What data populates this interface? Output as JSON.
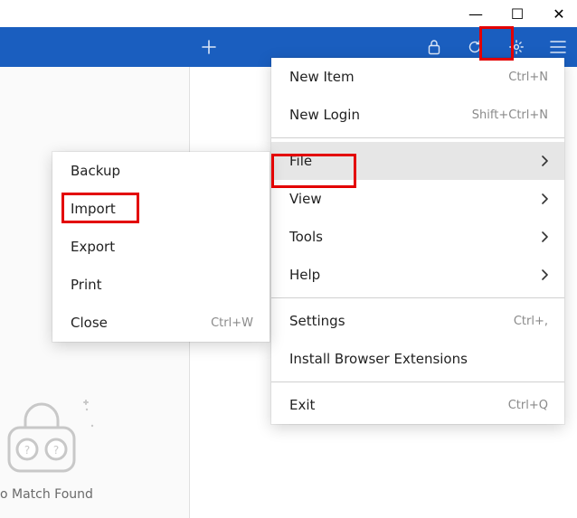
{
  "status_text": "o Match Found",
  "topbar": {
    "plus": "+",
    "lock_icon": "lock",
    "refresh_icon": "refresh",
    "gear_icon": "gear",
    "menu_icon": "hamburger"
  },
  "window_controls": {
    "minimize": "—",
    "maximize": "☐",
    "close": "✕"
  },
  "main_menu": [
    {
      "label": "New Item",
      "shortcut": "Ctrl+N"
    },
    {
      "label": "New Login",
      "shortcut": "Shift+Ctrl+N"
    },
    {
      "sep": true
    },
    {
      "label": "File",
      "submenu": true,
      "hover": true
    },
    {
      "label": "View",
      "submenu": true
    },
    {
      "label": "Tools",
      "submenu": true
    },
    {
      "label": "Help",
      "submenu": true
    },
    {
      "sep": true
    },
    {
      "label": "Settings",
      "shortcut": "Ctrl+,"
    },
    {
      "label": "Install Browser Extensions"
    },
    {
      "sep": true
    },
    {
      "label": "Exit",
      "shortcut": "Ctrl+Q"
    }
  ],
  "file_submenu": [
    {
      "label": "Backup"
    },
    {
      "label": "Import"
    },
    {
      "label": "Export"
    },
    {
      "label": "Print"
    },
    {
      "label": "Close",
      "shortcut": "Ctrl+W"
    }
  ]
}
